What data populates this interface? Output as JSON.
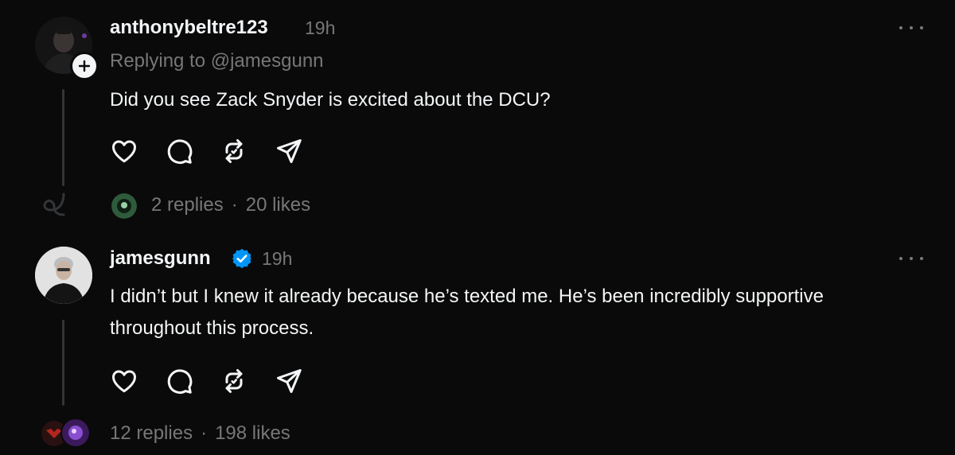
{
  "posts": [
    {
      "username": "anthonybeltre123",
      "time": "19h",
      "replying_to": "Replying to @jamesgunn",
      "text": "Did you see Zack Snyder is excited about the DCU?",
      "stats": {
        "replies": "2 replies",
        "separator": "·",
        "likes": "20 likes"
      },
      "icons": [
        "heart-icon",
        "comment-icon",
        "repost-icon",
        "share-icon"
      ]
    },
    {
      "username": "jamesgunn",
      "verified": true,
      "time": "19h",
      "text": "I didn’t but I knew it already because he’s texted me. He’s been incredibly supportive throughout this process.",
      "stats": {
        "replies": "12 replies",
        "separator": "·",
        "likes": "198 likes"
      },
      "icons": [
        "heart-icon",
        "comment-icon",
        "repost-icon",
        "share-icon"
      ]
    }
  ],
  "colors": {
    "background": "#0a0a0a",
    "text_primary": "#f3f5f7",
    "text_secondary": "#777777",
    "verified": "#0095f6",
    "thread_line": "#333638"
  }
}
